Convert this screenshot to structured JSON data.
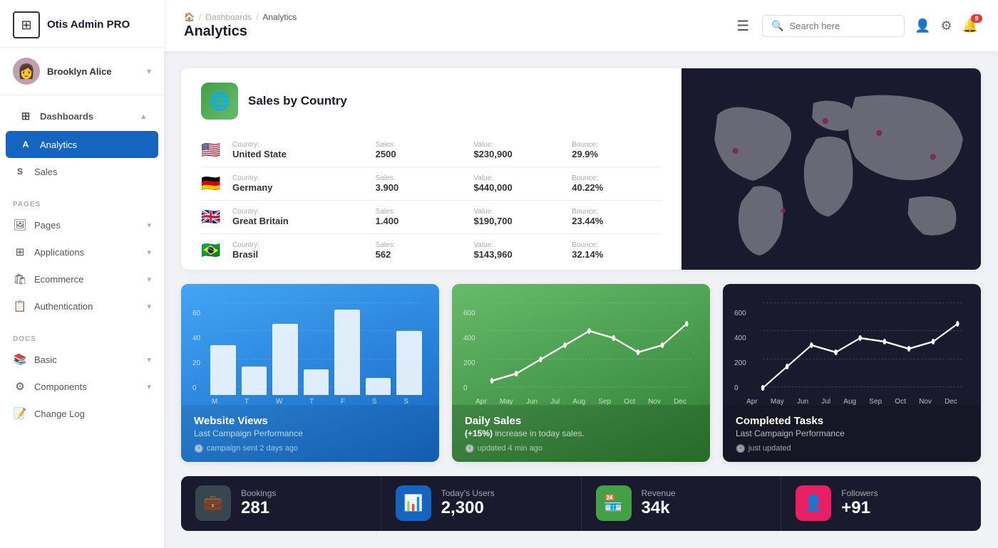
{
  "sidebar": {
    "logo": {
      "icon": "⊞",
      "text": "Otis Admin PRO"
    },
    "user": {
      "name": "Brooklyn Alice",
      "avatar": "👩"
    },
    "nav": {
      "dashboards_label": "Dashboards",
      "analytics_label": "Analytics",
      "sales_label": "Sales",
      "pages_section": "PAGES",
      "pages_label": "Pages",
      "applications_label": "Applications",
      "ecommerce_label": "Ecommerce",
      "authentication_label": "Authentication",
      "docs_section": "DOCS",
      "basic_label": "Basic",
      "components_label": "Components",
      "changelog_label": "Change Log"
    }
  },
  "header": {
    "breadcrumb": [
      "🏠",
      "/",
      "Dashboards",
      "/",
      "Analytics"
    ],
    "title": "Analytics",
    "search_placeholder": "Search here",
    "notification_count": "9"
  },
  "sales_by_country": {
    "title": "Sales by Country",
    "countries": [
      {
        "flag": "🇺🇸",
        "country_label": "Country:",
        "country": "United State",
        "sales_label": "Sales:",
        "sales": "2500",
        "value_label": "Value:",
        "value": "$230,900",
        "bounce_label": "Bounce:",
        "bounce": "29.9%"
      },
      {
        "flag": "🇩🇪",
        "country_label": "Country:",
        "country": "Germany",
        "sales_label": "Sales:",
        "sales": "3.900",
        "value_label": "Value:",
        "value": "$440,000",
        "bounce_label": "Bounce:",
        "bounce": "40.22%"
      },
      {
        "flag": "🇬🇧",
        "country_label": "Country:",
        "country": "Great Britain",
        "sales_label": "Sales:",
        "sales": "1.400",
        "value_label": "Value:",
        "value": "$190,700",
        "bounce_label": "Bounce:",
        "bounce": "23.44%"
      },
      {
        "flag": "🇧🇷",
        "country_label": "Country:",
        "country": "Brasil",
        "sales_label": "Sales:",
        "sales": "562",
        "value_label": "Value:",
        "value": "$143,960",
        "bounce_label": "Bounce:",
        "bounce": "32.14%"
      }
    ]
  },
  "charts": {
    "website_views": {
      "title": "Website Views",
      "subtitle": "Last Campaign Performance",
      "footer": "campaign sent 2 days ago",
      "y_labels": [
        "60",
        "40",
        "20",
        "0"
      ],
      "x_labels": [
        "M",
        "T",
        "W",
        "T",
        "F",
        "S",
        "S"
      ],
      "bars": [
        35,
        20,
        50,
        18,
        60,
        12,
        45
      ]
    },
    "daily_sales": {
      "title": "Daily Sales",
      "subtitle_prefix": "",
      "highlight": "(+15%)",
      "subtitle_suffix": "increase in today sales.",
      "footer": "updated 4 min ago",
      "y_labels": [
        "600",
        "400",
        "200",
        "0"
      ],
      "x_labels": [
        "Apr",
        "May",
        "Jun",
        "Jul",
        "Aug",
        "Sep",
        "Oct",
        "Nov",
        "Dec"
      ],
      "line_points": "30,100 90,90 150,70 210,50 270,30 330,40 390,60 450,50 510,20"
    },
    "completed_tasks": {
      "title": "Completed Tasks",
      "subtitle": "Last Campaign Performance",
      "footer": "just updated",
      "y_labels": [
        "600",
        "400",
        "200",
        "0"
      ],
      "x_labels": [
        "Apr",
        "May",
        "Jun",
        "Jul",
        "Aug",
        "Sep",
        "Oct",
        "Nov",
        "Dec"
      ],
      "line_points": "30,100 90,80 150,50 210,60 270,40 330,45 390,55 450,45 510,20"
    }
  },
  "stats": [
    {
      "icon": "💼",
      "icon_bg": "#37474f",
      "label": "Bookings",
      "value": "281"
    },
    {
      "icon": "📊",
      "icon_bg": "#1565c0",
      "label": "Today's Users",
      "value": "2,300"
    },
    {
      "icon": "🏪",
      "icon_bg": "#43a047",
      "label": "Revenue",
      "value": "34k"
    },
    {
      "icon": "👤",
      "icon_bg": "#e91e63",
      "label": "Followers",
      "value": "+91"
    }
  ]
}
